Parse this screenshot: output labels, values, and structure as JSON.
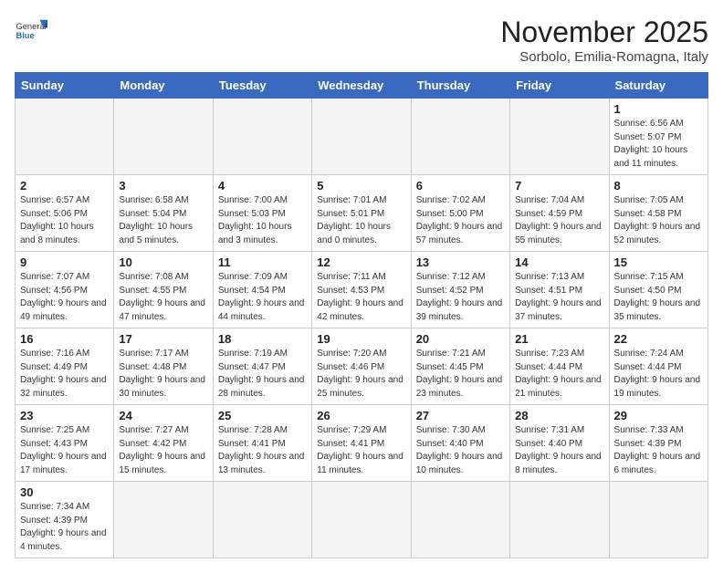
{
  "header": {
    "logo_general": "General",
    "logo_blue": "Blue",
    "title": "November 2025",
    "subtitle": "Sorbolo, Emilia-Romagna, Italy"
  },
  "days_of_week": [
    "Sunday",
    "Monday",
    "Tuesday",
    "Wednesday",
    "Thursday",
    "Friday",
    "Saturday"
  ],
  "weeks": [
    [
      {
        "day": "",
        "info": ""
      },
      {
        "day": "",
        "info": ""
      },
      {
        "day": "",
        "info": ""
      },
      {
        "day": "",
        "info": ""
      },
      {
        "day": "",
        "info": ""
      },
      {
        "day": "",
        "info": ""
      },
      {
        "day": "1",
        "info": "Sunrise: 6:56 AM\nSunset: 5:07 PM\nDaylight: 10 hours and 11 minutes."
      }
    ],
    [
      {
        "day": "2",
        "info": "Sunrise: 6:57 AM\nSunset: 5:06 PM\nDaylight: 10 hours and 8 minutes."
      },
      {
        "day": "3",
        "info": "Sunrise: 6:58 AM\nSunset: 5:04 PM\nDaylight: 10 hours and 5 minutes."
      },
      {
        "day": "4",
        "info": "Sunrise: 7:00 AM\nSunset: 5:03 PM\nDaylight: 10 hours and 3 minutes."
      },
      {
        "day": "5",
        "info": "Sunrise: 7:01 AM\nSunset: 5:01 PM\nDaylight: 10 hours and 0 minutes."
      },
      {
        "day": "6",
        "info": "Sunrise: 7:02 AM\nSunset: 5:00 PM\nDaylight: 9 hours and 57 minutes."
      },
      {
        "day": "7",
        "info": "Sunrise: 7:04 AM\nSunset: 4:59 PM\nDaylight: 9 hours and 55 minutes."
      },
      {
        "day": "8",
        "info": "Sunrise: 7:05 AM\nSunset: 4:58 PM\nDaylight: 9 hours and 52 minutes."
      }
    ],
    [
      {
        "day": "9",
        "info": "Sunrise: 7:07 AM\nSunset: 4:56 PM\nDaylight: 9 hours and 49 minutes."
      },
      {
        "day": "10",
        "info": "Sunrise: 7:08 AM\nSunset: 4:55 PM\nDaylight: 9 hours and 47 minutes."
      },
      {
        "day": "11",
        "info": "Sunrise: 7:09 AM\nSunset: 4:54 PM\nDaylight: 9 hours and 44 minutes."
      },
      {
        "day": "12",
        "info": "Sunrise: 7:11 AM\nSunset: 4:53 PM\nDaylight: 9 hours and 42 minutes."
      },
      {
        "day": "13",
        "info": "Sunrise: 7:12 AM\nSunset: 4:52 PM\nDaylight: 9 hours and 39 minutes."
      },
      {
        "day": "14",
        "info": "Sunrise: 7:13 AM\nSunset: 4:51 PM\nDaylight: 9 hours and 37 minutes."
      },
      {
        "day": "15",
        "info": "Sunrise: 7:15 AM\nSunset: 4:50 PM\nDaylight: 9 hours and 35 minutes."
      }
    ],
    [
      {
        "day": "16",
        "info": "Sunrise: 7:16 AM\nSunset: 4:49 PM\nDaylight: 9 hours and 32 minutes."
      },
      {
        "day": "17",
        "info": "Sunrise: 7:17 AM\nSunset: 4:48 PM\nDaylight: 9 hours and 30 minutes."
      },
      {
        "day": "18",
        "info": "Sunrise: 7:19 AM\nSunset: 4:47 PM\nDaylight: 9 hours and 28 minutes."
      },
      {
        "day": "19",
        "info": "Sunrise: 7:20 AM\nSunset: 4:46 PM\nDaylight: 9 hours and 25 minutes."
      },
      {
        "day": "20",
        "info": "Sunrise: 7:21 AM\nSunset: 4:45 PM\nDaylight: 9 hours and 23 minutes."
      },
      {
        "day": "21",
        "info": "Sunrise: 7:23 AM\nSunset: 4:44 PM\nDaylight: 9 hours and 21 minutes."
      },
      {
        "day": "22",
        "info": "Sunrise: 7:24 AM\nSunset: 4:44 PM\nDaylight: 9 hours and 19 minutes."
      }
    ],
    [
      {
        "day": "23",
        "info": "Sunrise: 7:25 AM\nSunset: 4:43 PM\nDaylight: 9 hours and 17 minutes."
      },
      {
        "day": "24",
        "info": "Sunrise: 7:27 AM\nSunset: 4:42 PM\nDaylight: 9 hours and 15 minutes."
      },
      {
        "day": "25",
        "info": "Sunrise: 7:28 AM\nSunset: 4:41 PM\nDaylight: 9 hours and 13 minutes."
      },
      {
        "day": "26",
        "info": "Sunrise: 7:29 AM\nSunset: 4:41 PM\nDaylight: 9 hours and 11 minutes."
      },
      {
        "day": "27",
        "info": "Sunrise: 7:30 AM\nSunset: 4:40 PM\nDaylight: 9 hours and 10 minutes."
      },
      {
        "day": "28",
        "info": "Sunrise: 7:31 AM\nSunset: 4:40 PM\nDaylight: 9 hours and 8 minutes."
      },
      {
        "day": "29",
        "info": "Sunrise: 7:33 AM\nSunset: 4:39 PM\nDaylight: 9 hours and 6 minutes."
      }
    ],
    [
      {
        "day": "30",
        "info": "Sunrise: 7:34 AM\nSunset: 4:39 PM\nDaylight: 9 hours and 4 minutes."
      },
      {
        "day": "",
        "info": ""
      },
      {
        "day": "",
        "info": ""
      },
      {
        "day": "",
        "info": ""
      },
      {
        "day": "",
        "info": ""
      },
      {
        "day": "",
        "info": ""
      },
      {
        "day": "",
        "info": ""
      }
    ]
  ]
}
